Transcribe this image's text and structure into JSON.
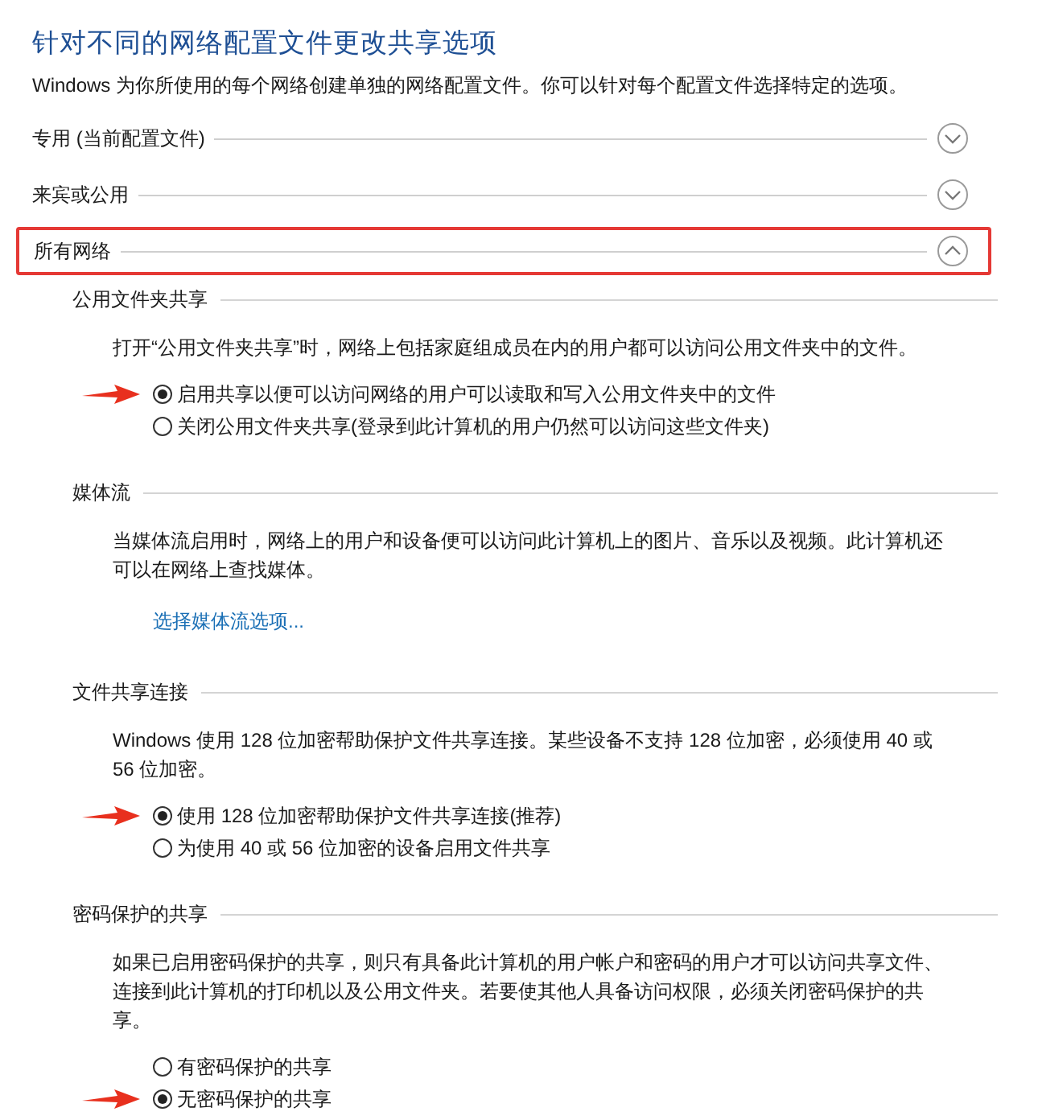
{
  "title": "针对不同的网络配置文件更改共享选项",
  "description": "Windows 为你所使用的每个网络创建单独的网络配置文件。你可以针对每个配置文件选择特定的选项。",
  "profiles": [
    {
      "label": "专用 (当前配置文件)",
      "expanded": false,
      "highlighted": false
    },
    {
      "label": "来宾或公用",
      "expanded": false,
      "highlighted": false
    },
    {
      "label": "所有网络",
      "expanded": true,
      "highlighted": true
    }
  ],
  "sections": [
    {
      "heading": "公用文件夹共享",
      "paragraph": "打开“公用文件夹共享”时，网络上包括家庭组成员在内的用户都可以访问公用文件夹中的文件。",
      "options": [
        {
          "label": "启用共享以便可以访问网络的用户可以读取和写入公用文件夹中的文件",
          "selected": true,
          "arrow": true
        },
        {
          "label": "关闭公用文件夹共享(登录到此计算机的用户仍然可以访问这些文件夹)",
          "selected": false,
          "arrow": false
        }
      ]
    },
    {
      "heading": "媒体流",
      "paragraph": "当媒体流启用时，网络上的用户和设备便可以访问此计算机上的图片、音乐以及视频。此计算机还可以在网络上查找媒体。",
      "link": "选择媒体流选项..."
    },
    {
      "heading": "文件共享连接",
      "paragraph": "Windows 使用 128 位加密帮助保护文件共享连接。某些设备不支持 128 位加密，必须使用 40 或 56 位加密。",
      "options": [
        {
          "label": "使用 128 位加密帮助保护文件共享连接(推荐)",
          "selected": true,
          "arrow": true
        },
        {
          "label": "为使用 40 或 56 位加密的设备启用文件共享",
          "selected": false,
          "arrow": false
        }
      ]
    },
    {
      "heading": "密码保护的共享",
      "paragraph": "如果已启用密码保护的共享，则只有具备此计算机的用户帐户和密码的用户才可以访问共享文件、连接到此计算机的打印机以及公用文件夹。若要使其他人具备访问权限，必须关闭密码保护的共享。",
      "options": [
        {
          "label": "有密码保护的共享",
          "selected": false,
          "arrow": false
        },
        {
          "label": "无密码保护的共享",
          "selected": true,
          "arrow": true
        }
      ]
    }
  ]
}
